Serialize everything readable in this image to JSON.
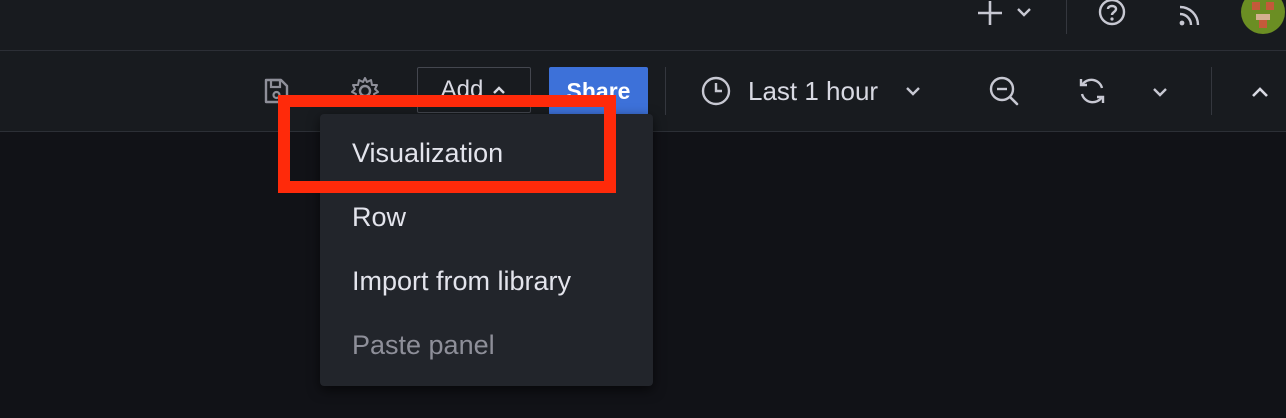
{
  "topbar": {
    "icons": [
      "plus-icon",
      "chevron-down-icon",
      "help-icon",
      "rss-icon",
      "avatar"
    ]
  },
  "toolbar": {
    "add_label": "Add",
    "share_label": "Share",
    "time_range_label": "Last 1 hour",
    "icons": [
      "save-icon",
      "gear-icon",
      "clock-icon",
      "zoom-out-icon",
      "refresh-icon",
      "chevron-up-icon"
    ]
  },
  "add_menu": {
    "items": [
      {
        "label": "Visualization",
        "disabled": false
      },
      {
        "label": "Row",
        "disabled": false
      },
      {
        "label": "Import from library",
        "disabled": false
      },
      {
        "label": "Paste panel",
        "disabled": true
      }
    ]
  },
  "colors": {
    "background": "#111217",
    "bar": "#181b1f",
    "menu": "#22252b",
    "primary": "#3d71d9",
    "highlight": "#ff2a0a"
  }
}
